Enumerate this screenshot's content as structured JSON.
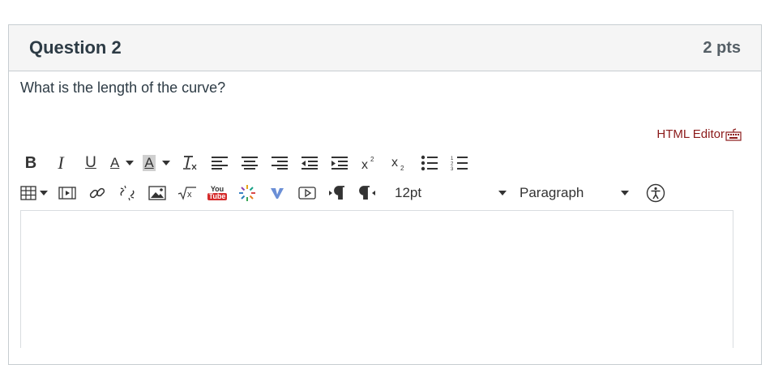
{
  "question": {
    "title": "Question 2",
    "points": "2 pts",
    "text": "What is the length of the curve?"
  },
  "editor": {
    "html_editor_label": "HTML Editor",
    "font_size": "12pt",
    "format": "Paragraph"
  },
  "toolbar": {
    "bold_label": "B",
    "italic_label": "I",
    "underline_label": "U",
    "text_color_label": "A",
    "background_color_label": "A",
    "youtube_top": "You",
    "youtube_bottom": "Tube"
  },
  "colors": {
    "html_editor_link": "#8b1a1a",
    "header_bg": "#f5f5f5",
    "border": "#c7cdd1"
  }
}
